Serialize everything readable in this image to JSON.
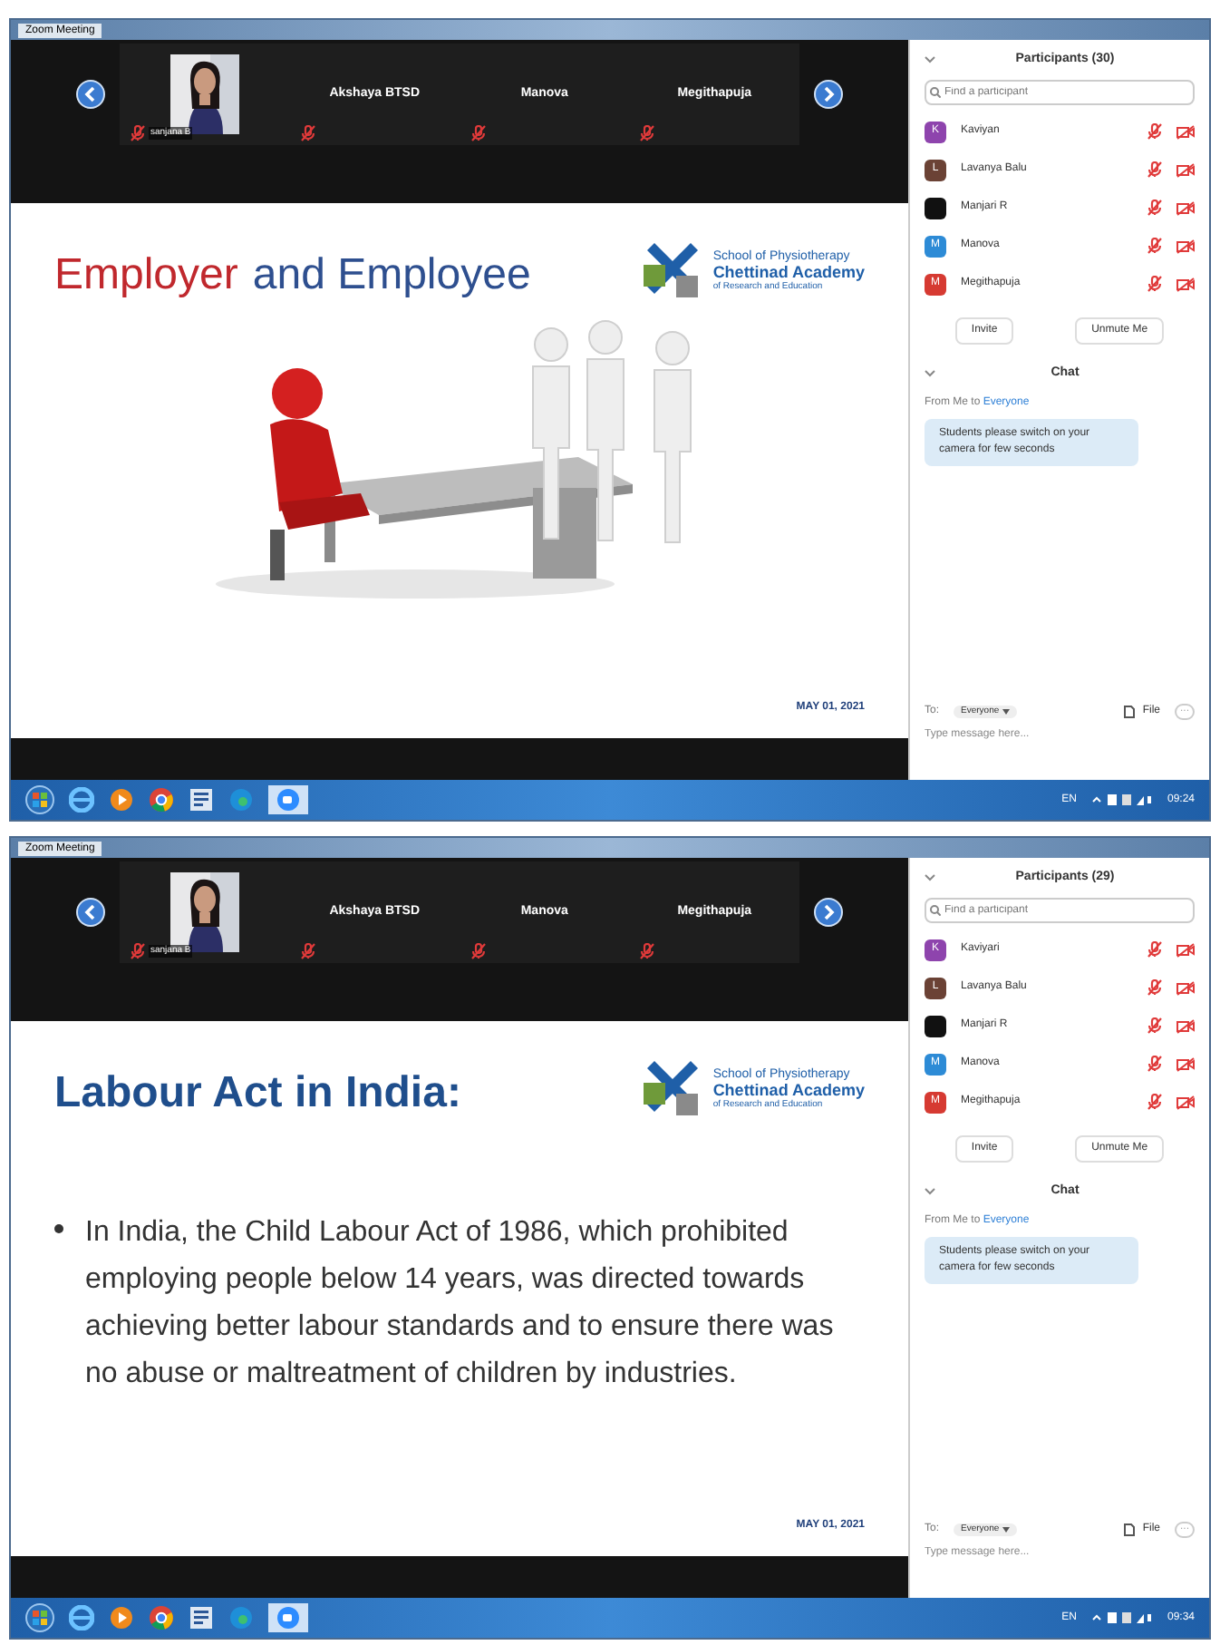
{
  "screens": [
    {
      "window": {
        "title": "Zoom Meeting"
      },
      "video_strip": {
        "tiles": [
          {
            "name": "sanjana B"
          },
          {
            "kind": "name",
            "name": "Akshaya BTSD"
          },
          {
            "kind": "name",
            "name": "Manova"
          },
          {
            "kind": "name",
            "name": "Megithapuja"
          }
        ]
      },
      "slide": {
        "kind": "illustration",
        "title_parts": [
          {
            "text": "Employer",
            "color": "#c0282d"
          },
          {
            "text": "and Employee",
            "color": "#2e4f8f"
          }
        ],
        "logo": {
          "line_1": "School of Physiotherapy",
          "line_2": "Chettinad Academy",
          "line_3": "of Research and Education"
        },
        "date": "MAY 01, 2021"
      },
      "participants": {
        "title": "Participants (30)",
        "search": {
          "placeholder": "Find a participant"
        },
        "items": [
          {
            "name": "Kaviyan",
            "initial": "K",
            "color": "#8e44ad"
          },
          {
            "name": "Lavanya Balu",
            "initial": "L",
            "color": "#6b4235"
          },
          {
            "name": "Manjari R",
            "color": "#111111"
          },
          {
            "name": "Manova",
            "initial": "M",
            "color": "#2d8bd6"
          },
          {
            "name": "Megithapuja",
            "initial": "M",
            "color": "#d63a32"
          }
        ],
        "buttons": [
          "Invite",
          "Unmute Me"
        ]
      },
      "chat": {
        "title": "Chat",
        "from": "From Me to",
        "to_name": "Everyone",
        "message": "Students please switch on your camera for few seconds",
        "to_label": "To:",
        "recipient": "Everyone",
        "file": "File",
        "more": "···",
        "input": {
          "placeholder": "Type message here..."
        }
      },
      "taskbar": {
        "language": "EN",
        "time": "09:24"
      }
    },
    {
      "window": {
        "title": "Zoom Meeting"
      },
      "video_strip": {
        "tiles": [
          {
            "name": "sanjana B"
          },
          {
            "kind": "name",
            "name": "Akshaya BTSD"
          },
          {
            "kind": "name",
            "name": "Manova"
          },
          {
            "kind": "name",
            "name": "Megithapuja"
          }
        ]
      },
      "slide": {
        "kind": "text",
        "title_parts": [
          {
            "text": "Labour Act in India:",
            "color": "#1f4e8c"
          }
        ],
        "logo": {
          "line_1": "School of Physiotherapy",
          "line_2": "Chettinad Academy",
          "line_3": "of Research and Education"
        },
        "bullets": [
          "In India, the Child Labour Act of 1986, which prohibited employing people below 14 years, was directed towards achieving better labour standards and to ensure there was no abuse or maltreatment of children by industries."
        ],
        "date": "MAY 01, 2021"
      },
      "participants": {
        "title": "Participants (29)",
        "search": {
          "placeholder": "Find a participant"
        },
        "items": [
          {
            "name": "Kaviyari",
            "initial": "K",
            "color": "#8e44ad"
          },
          {
            "name": "Lavanya Balu",
            "initial": "L",
            "color": "#6b4235"
          },
          {
            "name": "Manjari R",
            "color": "#111111"
          },
          {
            "name": "Manova",
            "initial": "M",
            "color": "#2d8bd6"
          },
          {
            "name": "Megithapuja",
            "initial": "M",
            "color": "#d63a32"
          }
        ],
        "buttons": [
          "Invite",
          "Unmute Me"
        ]
      },
      "chat": {
        "title": "Chat",
        "from": "From Me to",
        "to_name": "Everyone",
        "message": "Students please switch on your camera for few seconds",
        "to_label": "To:",
        "recipient": "Everyone",
        "file": "File",
        "more": "···",
        "input": {
          "placeholder": "Type message here..."
        }
      },
      "taskbar": {
        "language": "EN",
        "time": "09:34"
      }
    }
  ]
}
